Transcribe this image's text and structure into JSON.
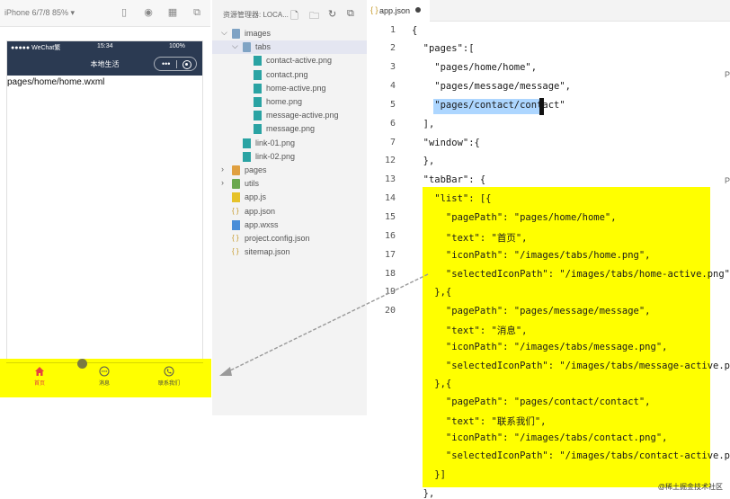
{
  "simulator": {
    "device_label": "iPhone 6/7/8 85% ▾",
    "status_carrier": "●●●●● WeChat繁",
    "status_time": "15:34",
    "status_battery": "100%",
    "nav_title": "本地生活",
    "capsule_dots": "•••",
    "page_path": "pages/home/home.wxml",
    "tabs": [
      {
        "label": "首页",
        "icon": "home-icon",
        "color": "#e64340"
      },
      {
        "label": "消息",
        "icon": "message-icon",
        "color": "#555555"
      },
      {
        "label": "联系我们",
        "icon": "phone-icon",
        "color": "#555555"
      }
    ]
  },
  "explorer": {
    "title": "资源管理器: LOCA...",
    "tree": [
      {
        "label": "images",
        "type": "folder",
        "depth": 0,
        "open": true
      },
      {
        "label": "tabs",
        "type": "folder",
        "depth": 1,
        "open": true,
        "selected": true
      },
      {
        "label": "contact-active.png",
        "type": "image",
        "depth": 2
      },
      {
        "label": "contact.png",
        "type": "image",
        "depth": 2
      },
      {
        "label": "home-active.png",
        "type": "image",
        "depth": 2
      },
      {
        "label": "home.png",
        "type": "image",
        "depth": 2
      },
      {
        "label": "message-active.png",
        "type": "image",
        "depth": 2
      },
      {
        "label": "message.png",
        "type": "image",
        "depth": 2
      },
      {
        "label": "link-01.png",
        "type": "image",
        "depth": 1
      },
      {
        "label": "link-02.png",
        "type": "image",
        "depth": 1
      },
      {
        "label": "pages",
        "type": "folder-orange",
        "depth": 0,
        "open": false
      },
      {
        "label": "utils",
        "type": "folder-green",
        "depth": 0,
        "open": false
      },
      {
        "label": "app.js",
        "type": "js",
        "depth": 0
      },
      {
        "label": "app.json",
        "type": "json",
        "depth": 0
      },
      {
        "label": "app.wxss",
        "type": "wxss",
        "depth": 0
      },
      {
        "label": "project.config.json",
        "type": "json",
        "depth": 0
      },
      {
        "label": "sitemap.json",
        "type": "json",
        "depth": 0
      }
    ]
  },
  "editor": {
    "tab_icon": "{ }",
    "tab_name": "app.json",
    "line_numbers": [
      "1",
      "2",
      "3",
      "4",
      "5",
      "6",
      "7",
      "12",
      "13",
      "14",
      "15",
      "16",
      "17",
      "18",
      "19",
      "20"
    ],
    "lines": [
      "{",
      "  \"pages\":[",
      "    \"pages/home/home\",",
      "    \"pages/message/message\",",
      "    \"pages/contact/contact\"",
      "  ],",
      "  \"window\":{",
      "  },",
      "  \"tabBar\": {",
      "    \"list\": [{",
      "      \"pagePath\": \"pages/home/home\",",
      "      \"text\": \"首页\",",
      "      \"iconPath\": \"/images/tabs/home.png\",",
      "      \"selectedIconPath\": \"/images/tabs/home-active.png\"",
      "    },{",
      "      \"pagePath\": \"pages/message/message\",",
      "      \"text\": \"消息\",",
      "      \"iconPath\": \"/images/tabs/message.png\",",
      "      \"selectedIconPath\": \"/images/tabs/message-active.png\"",
      "    },{",
      "      \"pagePath\": \"pages/contact/contact\",",
      "      \"text\": \"联系我们\",",
      "      \"iconPath\": \"/images/tabs/contact.png\",",
      "      \"selectedIconPath\": \"/images/tabs/contact-active.png\"",
      "    }]",
      "  },"
    ],
    "side_marks": [
      "P",
      "P"
    ],
    "watermark": "@稀土掘金技术社区"
  },
  "colors": {
    "highlight": "#ffff00",
    "navbar": "#2b3a52",
    "selection": "#add6ff"
  }
}
